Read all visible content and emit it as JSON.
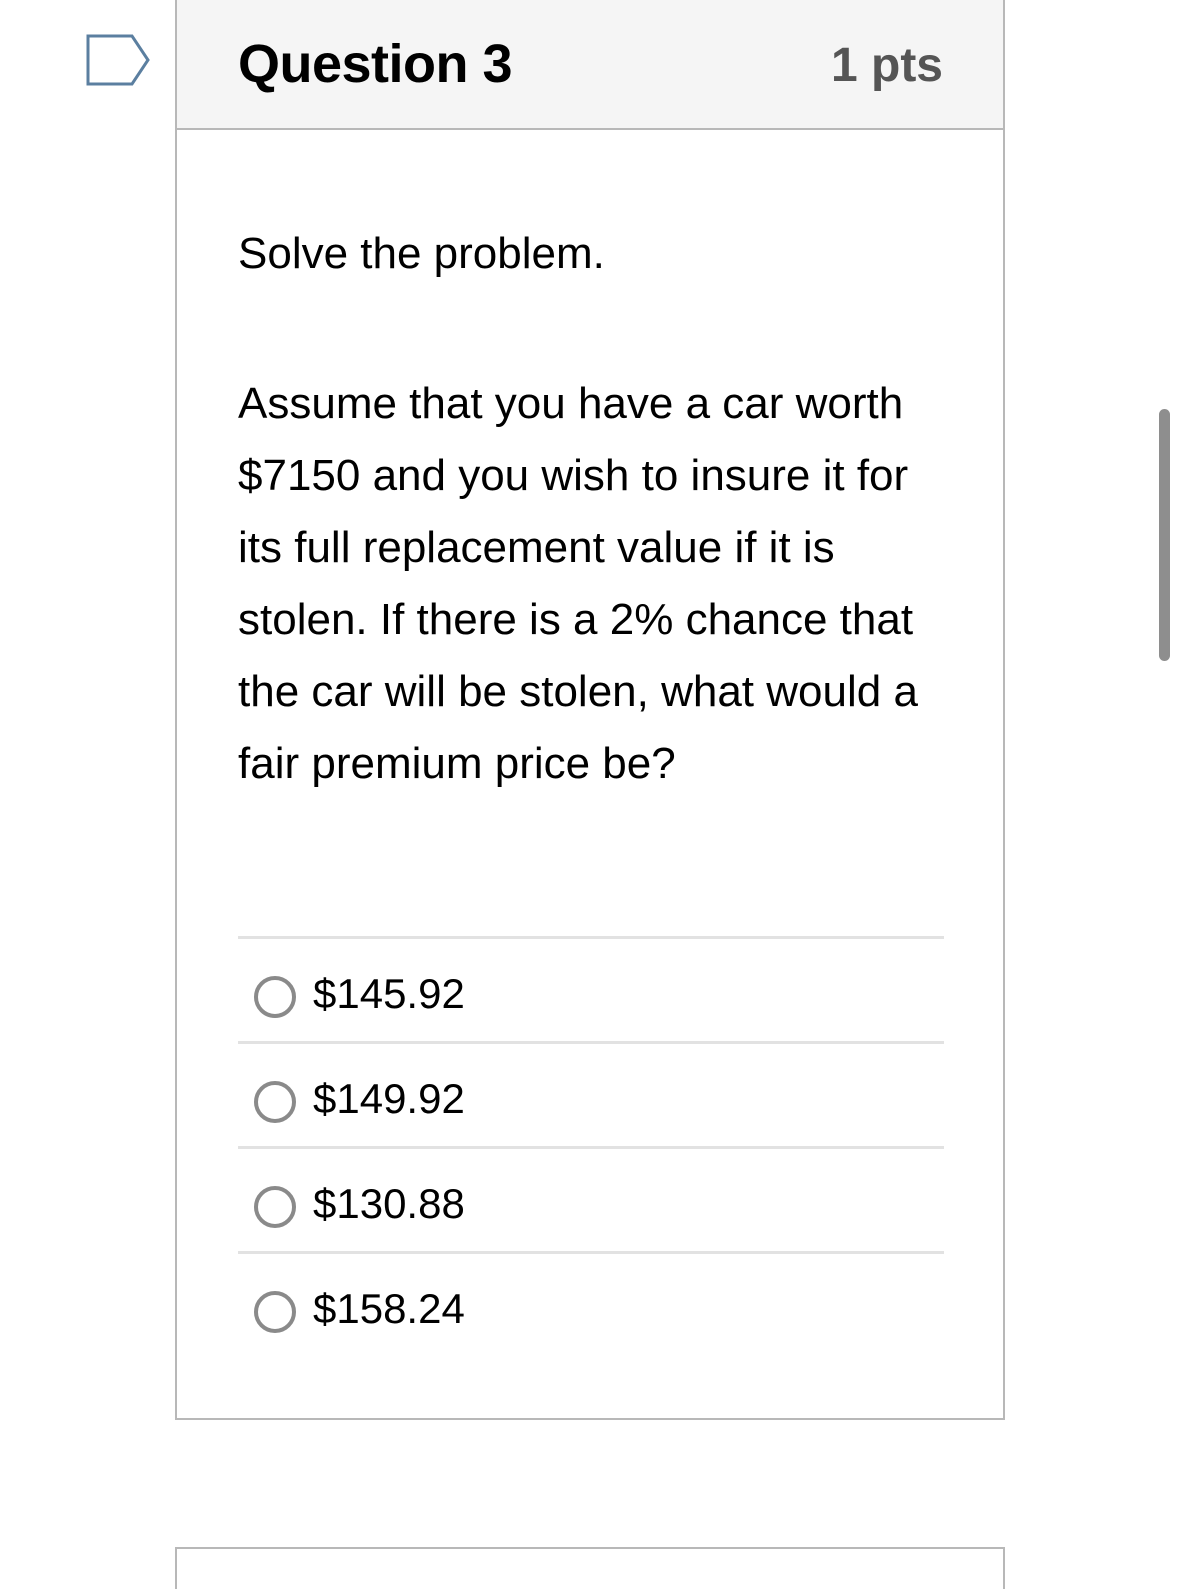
{
  "question": {
    "title": "Question 3",
    "points": "1 pts",
    "instruction": "Solve the problem.",
    "text": "Assume that you have a car worth $7150 and you wish to insure it for its full replacement value if it is stolen. If there is a 2% chance that the car will be stolen, what would a fair premium price be?",
    "answers": [
      {
        "label": "$145.92"
      },
      {
        "label": "$149.92"
      },
      {
        "label": "$130.88"
      },
      {
        "label": "$158.24"
      }
    ]
  },
  "icons": {
    "flag": "flag-question-icon"
  },
  "colors": {
    "header_bg": "#f5f5f5",
    "border": "#b8b8b8",
    "points_text": "#555555",
    "radio_border": "#8a8a8a",
    "flag_stroke": "#5b7fa0"
  }
}
